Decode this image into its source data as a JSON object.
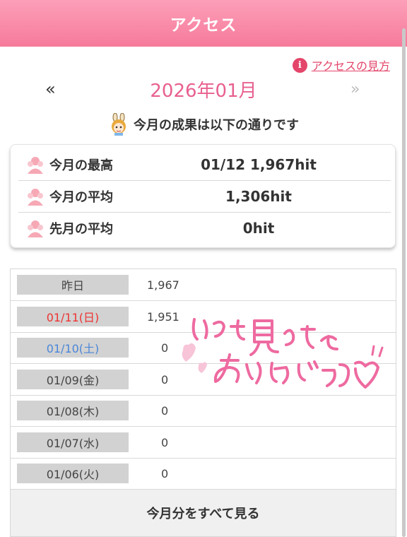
{
  "header": {
    "title": "アクセス"
  },
  "help": {
    "label": "アクセスの見方",
    "icon": "info-icon"
  },
  "month_nav": {
    "prev": "«",
    "current": "2026年01月",
    "next": "»"
  },
  "summary": {
    "message": "今月の成果は以下の通りです",
    "icon": "mascot-icon"
  },
  "stats": [
    {
      "label": "今月の最高",
      "value": "01/12 1,967hit"
    },
    {
      "label": "今月の平均",
      "value": "1,306hit"
    },
    {
      "label": "先月の平均",
      "value": "0hit"
    }
  ],
  "daily": [
    {
      "label": "昨日",
      "hits": "1,967"
    },
    {
      "label": "01/11(日)",
      "hits": "1,951",
      "color": "#e33333"
    },
    {
      "label": "01/10(土)",
      "hits": "0",
      "color": "#4a86d8"
    },
    {
      "label": "01/09(金)",
      "hits": "0"
    },
    {
      "label": "01/08(木)",
      "hits": "0"
    },
    {
      "label": "01/07(水)",
      "hits": "0"
    },
    {
      "label": "01/06(火)",
      "hits": "0"
    }
  ],
  "view_all": "今月分をすべて見る",
  "handwritten_note": "いつも見てくれてありがとう♡"
}
